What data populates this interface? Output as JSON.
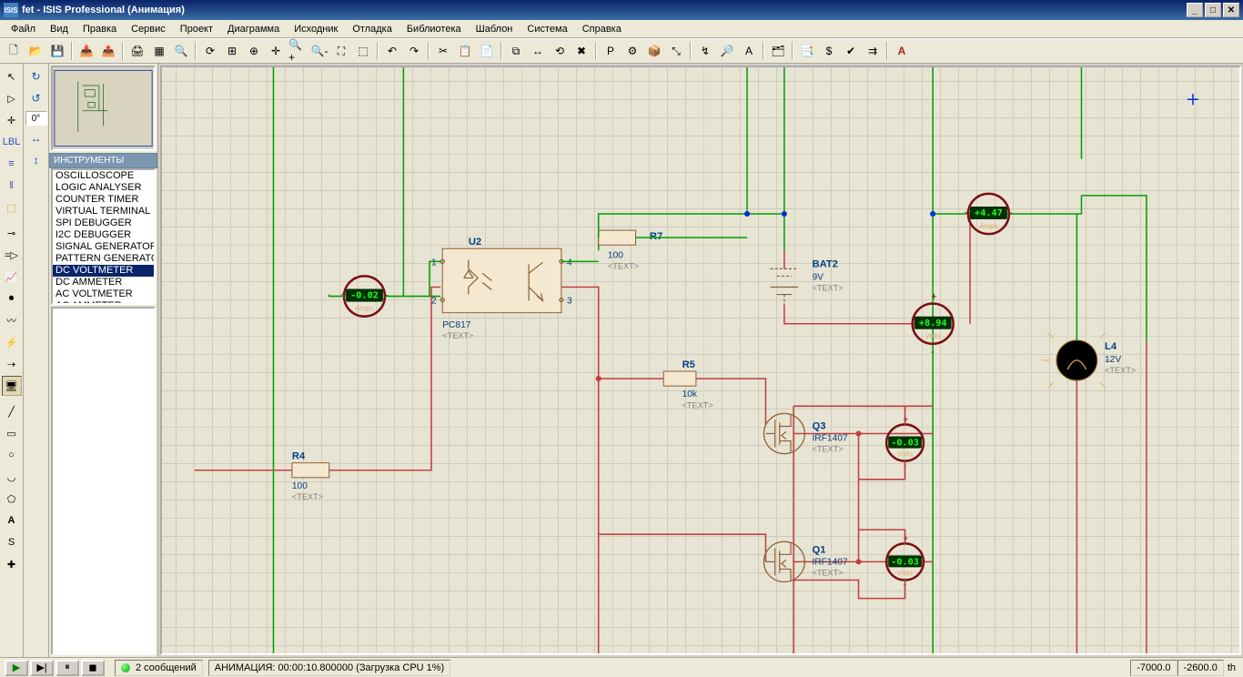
{
  "window": {
    "title": "fet - ISIS Professional (Анимация)"
  },
  "menu": [
    "Файл",
    "Вид",
    "Правка",
    "Сервис",
    "Проект",
    "Диаграмма",
    "Исходник",
    "Отладка",
    "Библиотека",
    "Шаблон",
    "Система",
    "Справка"
  ],
  "angle": "0°",
  "panel": {
    "header": "ИНСТРУМЕНТЫ",
    "items": [
      "OSCILLOSCOPE",
      "LOGIC ANALYSER",
      "COUNTER TIMER",
      "VIRTUAL TERMINAL",
      "SPI DEBUGGER",
      "I2C DEBUGGER",
      "SIGNAL GENERATOR",
      "PATTERN GENERATOR",
      "DC VOLTMETER",
      "DC AMMETER",
      "AC VOLTMETER",
      "AC AMMETER"
    ],
    "selected": 8
  },
  "status": {
    "messages": "2 сообщений",
    "anim": "АНИМАЦИЯ: 00:00:10.800000 (Загрузка CPU 1%)",
    "coord_x": "-7000.0",
    "coord_y": "-2600.0",
    "units": "th"
  },
  "schematic": {
    "u2": {
      "ref": "U2",
      "part": "PC817",
      "note": "<TEXT>",
      "pin1": "1",
      "pin2": "2",
      "pin3": "3",
      "pin4": "4"
    },
    "r4": {
      "ref": "R4",
      "val": "100",
      "note": "<TEXT>"
    },
    "r5": {
      "ref": "R5",
      "val": "10k",
      "note": "<TEXT>"
    },
    "r7": {
      "ref": "R7",
      "val": "100",
      "note": "<TEXT>"
    },
    "bat2": {
      "ref": "BAT2",
      "val": "9V",
      "note": "<TEXT>"
    },
    "q1": {
      "ref": "Q1",
      "part": "IRF1407",
      "note": "<TEXT>"
    },
    "q3": {
      "ref": "Q3",
      "part": "IRF1407",
      "note": "<TEXT>"
    },
    "l4": {
      "ref": "L4",
      "val": "12V",
      "note": "<TEXT>"
    },
    "meters": {
      "a1": {
        "val": "-0.02",
        "unit": "Amps"
      },
      "a2": {
        "val": "+4.47",
        "unit": "Amps"
      },
      "v1": {
        "val": "+8.94",
        "unit": "Volts"
      },
      "v2": {
        "val": "-0.03",
        "unit": "Volts"
      },
      "v3": {
        "val": "-0.03",
        "unit": "Volts"
      }
    }
  }
}
